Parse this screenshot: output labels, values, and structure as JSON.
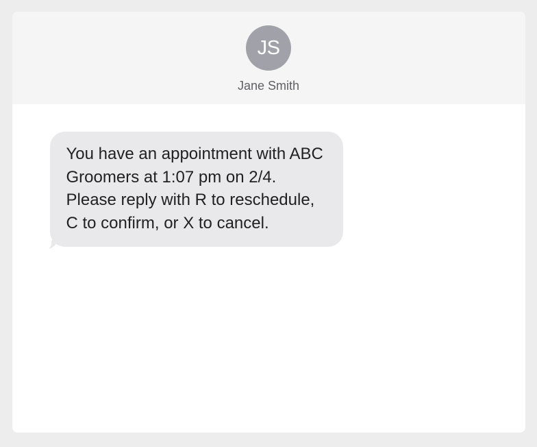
{
  "header": {
    "avatar_initials": "JS",
    "contact_name": "Jane Smith"
  },
  "messages": [
    {
      "text": "You have an appointment with ABC Groomers at 1:07 pm on 2/4. Please reply with R to reschedule, C to confirm, or X to cancel."
    }
  ]
}
